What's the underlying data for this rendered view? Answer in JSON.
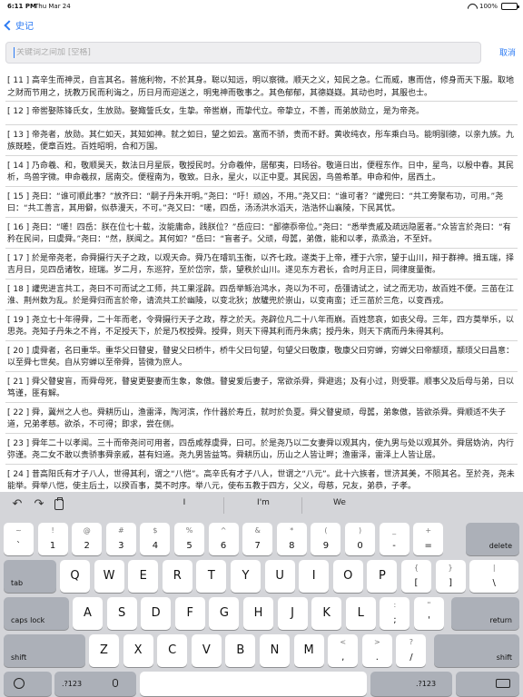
{
  "status": {
    "time": "6:11 PM",
    "date": "Thu Mar 24",
    "battery": "100%"
  },
  "nav": {
    "back_label": "史记"
  },
  "search": {
    "placeholder": "关键词之间加 [空格]",
    "cancel_label": "取消"
  },
  "entries": [
    "[ 11 ] 高辛生而神灵，自言其名。普施利物，不於其身。聪以知远，明以察微。顺天之义，知民之急。仁而威，惠而信，修身而天下服。取地之财而节用之，抚教万民而利诲之，历日月而迎送之，明鬼神而敬事之。其色郁郁，其德嶷嶷。其动也时，其服也士。",
    "[ 12 ] 帝喾娶陈锋氏女，生放勋。娶娵訾氏女，生挚。帝喾崩，而挚代立。帝挚立，不善，而弟放勋立，是为帝尧。",
    "[ 13 ] 帝尧者，放勋。其仁如天，其知如神。就之如日，望之如云。富而不骄，贵而不舒。黄收纯衣，彤车乘白马。能明驯德，以亲九族。九族既睦，便章百姓。百姓昭明，合和万国。",
    "[ 14 ] 乃命羲、和，敬顺昊天，数法日月星辰，敬授民时。分命羲仲，居郁夷，曰旸谷。敬道日出，便程东作。日中，星鸟，以殷中春。其民析，鸟兽字微。申命羲叔，居南交。便程南为，敬致。日永，星火，以正中夏。其民因，鸟兽希革。申命和仲，居西土。",
    "[ 15 ] 尧曰：“谁可顺此事？”放齐曰：“嗣子丹朱开明。”尧曰：“吁！顽凶，不用。”尧又曰：“谁可者？”讙兜曰：“共工旁聚布功，可用。”尧曰：“共工善言，其用僻，似恭漫天，不可。”尧又曰：“嗟，四岳，汤汤洪水滔天，浩浩怀山襄陵，下民其忧。",
    "[ 16 ] 尧曰：“嗟！四岳：朕在位七十载，汝能庸命，践朕位？”岳应曰：“鄙德忝帝位。”尧曰：“悉举贵戚及疏远隐匿者。”众皆言於尧曰：“有矜在民间，曰虞舜。”尧曰：“然，朕闻之。其何如？”岳曰：“盲者子。父顽，母嚚，弟傲，能和以孝，烝烝治，不至奸。",
    "[ 17 ] 於是帝尧老，命舜摄行天子之政，以观天命。舜乃在璿玑玉衡，以齐七政。遂类于上帝，禋于六宗，望于山川，辩于群神。揖五瑞，择吉月日，见四岳诸牧，班瑞。岁二月，东巡狩，至於岱宗，祡，望秩於山川。遂见东方君长，合时月正日，同律度量衡。",
    "[ 18 ] 讙兜进言共工，尧曰不可而试之工师，共工果淫辟。四岳举鲧治鸿水，尧以为不可，岳彊请试之，试之而无功，故百姓不便。三苗在江淮、荆州数为乱。於是舜归而言於帝，请流共工於幽陵，以变北狄；放驩兜於崇山，以变南蛮；迁三苗於三危，以变西戎。",
    "[ 19 ] 尧立七十年得舜，二十年而老，令舜摄行天子之政，荐之於天。尧辟位凡二十八年而崩。百姓悲哀，如丧父母。三年，四方莫举乐，以思尧。尧知子丹朱之不肖，不足授天下，於是乃权授舜。授舜，则天下得其利而丹朱病；授丹朱，则天下病而丹朱得其利。",
    "[ 20 ] 虞舜者，名曰重华。重华父曰瞽叟，瞽叟父曰桥牛，桥牛父曰句望，句望父曰敬康，敬康父曰穷蝉，穷蝉父曰帝颛顼，颛顼父曰昌意：以至舜七世矣。自从穷蝉以至帝舜，皆微为庶人。",
    "[ 21 ] 舜父瞽叟盲，而舜母死，瞽叟更娶妻而生象，象傲。瞽叟爱后妻子，常欲杀舜，舜避逃；及有小过，则受罪。顺事父及后母与弟，日以笃谨，匪有解。",
    "[ 22 ] 舜，冀州之人也。舜耕历山，渔雷泽，陶河滨，作什器於寿丘，就时於负夏。舜父瞽叟顽，母嚚，弟象傲，皆欲杀舜。舜顺适不失子道，兄弟孝慈。欲杀，不可得；即求，尝在侧。",
    "[ 23 ] 舜年二十以孝闻。三十而帝尧问可用者，四岳咸荐虞舜，曰可。於是尧乃以二女妻舜以观其内，使九男与处以观其外。舜居妫汭，内行弥谨。尧二女不敢以贵骄事舜亲戚，甚有妇道。尧九男皆益笃。舜耕历山，历山之人皆让畔；渔雷泽，雷泽上人皆让居。",
    "[ 24 ] 昔高阳氏有才子八人，世得其利，谓之“八恺”。高辛氏有才子八人，世谓之“八元”。此十六族者，世济其美，不陨其名。至於尧，尧未能举。舜举八恺，使主后土，以揆百事，莫不时序。举八元，使布五教于四方，父义，母慈，兄友，弟恭，子孝。"
  ],
  "keyboard": {
    "suggestions": [
      "I",
      "I'm",
      "We"
    ],
    "row_numbers": [
      {
        "top": "~",
        "bot": "`"
      },
      {
        "top": "!",
        "bot": "1"
      },
      {
        "top": "@",
        "bot": "2"
      },
      {
        "top": "#",
        "bot": "3"
      },
      {
        "top": "$",
        "bot": "4"
      },
      {
        "top": "%",
        "bot": "5"
      },
      {
        "top": "^",
        "bot": "6"
      },
      {
        "top": "&",
        "bot": "7"
      },
      {
        "top": "*",
        "bot": "8"
      },
      {
        "top": "(",
        "bot": "9"
      },
      {
        "top": ")",
        "bot": "0"
      },
      {
        "top": "_",
        "bot": "-"
      },
      {
        "top": "+",
        "bot": "="
      }
    ],
    "delete_label": "delete",
    "tab_label": "tab",
    "row_q": [
      "Q",
      "W",
      "E",
      "R",
      "T",
      "Y",
      "U",
      "I",
      "O",
      "P"
    ],
    "bracket_keys": [
      {
        "top": "{",
        "bot": "["
      },
      {
        "top": "}",
        "bot": "]"
      },
      {
        "top": "|",
        "bot": "\\"
      }
    ],
    "caps_label": "caps lock",
    "row_a": [
      "A",
      "S",
      "D",
      "F",
      "G",
      "H",
      "J",
      "K",
      "L"
    ],
    "semicolon_key": {
      "top": ":",
      "bot": ";"
    },
    "quote_key": {
      "top": "\"",
      "bot": "'"
    },
    "return_label": "return",
    "shift_label": "shift",
    "row_z": [
      "Z",
      "X",
      "C",
      "V",
      "B",
      "N",
      "M"
    ],
    "comma_key": {
      "top": "<",
      "bot": ","
    },
    "period_key": {
      "top": ">",
      "bot": "."
    },
    "slash_key": {
      "top": "?",
      "bot": "/"
    },
    "numbers_label": ".?123"
  }
}
